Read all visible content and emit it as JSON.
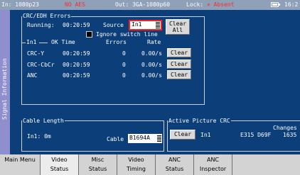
{
  "status_bar": {
    "input": "In: 1080p23",
    "aes": "NO AES",
    "output": "Out: 3GA-1080p60",
    "lock_label": "Lock:",
    "lock_value": "× Absent",
    "time": "16:2",
    "colors": {
      "background": "#8fa1b8",
      "alert": "#ff2a2a"
    }
  },
  "sidebar": {
    "label": "Signal Information"
  },
  "crc_edh": {
    "title": "CRC/EDH Errors",
    "running_label": "Running:",
    "running_time": "00:20:59",
    "source_label": "Source",
    "source_value": "In1",
    "clear_all_line1": "Clear",
    "clear_all_line2": "All",
    "ignore_switch_line": "Ignore switch line",
    "ignore_switch_checked": false,
    "in_label": "In1",
    "headers": {
      "ok_time": "OK Time",
      "errors": "Errors",
      "rate": "Rate"
    },
    "rows": [
      {
        "name": "CRC-Y",
        "ok_time": "00:20:59",
        "errors": "0",
        "rate": "0.00/s",
        "clear": "Clear"
      },
      {
        "name": "CRC-CbCr",
        "ok_time": "00:20:59",
        "errors": "0",
        "rate": "0.00/s",
        "clear": "Clear"
      },
      {
        "name": "ANC",
        "ok_time": "00:20:59",
        "errors": "0",
        "rate": "0.00/s",
        "clear": "Clear"
      }
    ]
  },
  "cable_length": {
    "title": "Cable Length",
    "in_label": "In1: 0m",
    "cable_label": "Cable",
    "cable_value": "B1694A"
  },
  "active_picture_crc": {
    "title": "Active Picture CRC",
    "changes_label": "Changes",
    "clear": "Clear",
    "in_label": "In1",
    "crc_value": "E315 D69F",
    "changes_value": "1635"
  },
  "tabs": [
    {
      "line1": "Main Menu",
      "line2": ""
    },
    {
      "line1": "Video",
      "line2": "Status",
      "active": true
    },
    {
      "line1": "Misc",
      "line2": "Status"
    },
    {
      "line1": "Video",
      "line2": "Timing"
    },
    {
      "line1": "ANC",
      "line2": "Status"
    },
    {
      "line1": "ANC",
      "line2": "Inspector"
    }
  ],
  "colors": {
    "screen_bg": "#0c3f7a",
    "sidebar": "#8f8fd0",
    "tab_bar": "#d3d3d3"
  }
}
